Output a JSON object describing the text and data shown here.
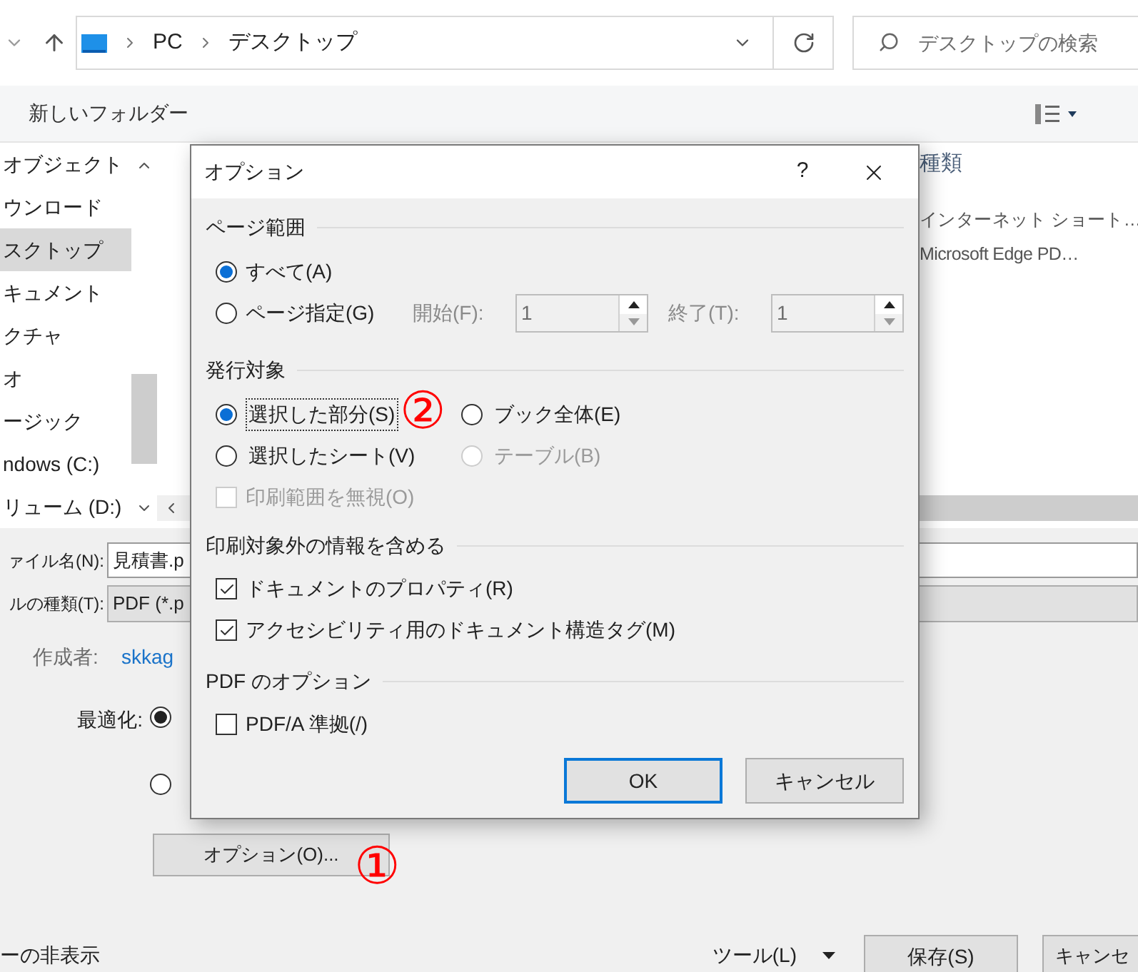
{
  "explorer": {
    "address": {
      "segments": [
        "PC",
        "デスクトップ"
      ]
    },
    "search": {
      "placeholder": "デスクトップの検索"
    },
    "toolbar": {
      "new_folder": "新しいフォルダー"
    },
    "sidebar": {
      "items": [
        {
          "label": "オブジェクト",
          "selected": false
        },
        {
          "label": "ウンロード",
          "selected": false
        },
        {
          "label": "スクトップ",
          "selected": true
        },
        {
          "label": "キュメント",
          "selected": false
        },
        {
          "label": "クチャ",
          "selected": false
        },
        {
          "label": "オ",
          "selected": false
        },
        {
          "label": "ージック",
          "selected": false
        },
        {
          "label": "ndows (C:)",
          "selected": false
        },
        {
          "label": "リューム (D:)",
          "selected": false
        }
      ]
    },
    "file_list": {
      "columns": [
        "種類"
      ],
      "rows": [
        {
          "type": "インターネット ショート…"
        },
        {
          "type": "Microsoft Edge PD…"
        }
      ]
    },
    "form": {
      "file_name": {
        "label": "ァイル名(N):",
        "value": "見積書.p"
      },
      "file_type": {
        "label": "ルの種類(T):",
        "value": "PDF (*.p"
      },
      "author": {
        "label": "作成者:",
        "value": "skkag"
      },
      "optimize": {
        "label": "最適化:",
        "options": [
          {
            "selected": true
          },
          {
            "selected": false
          }
        ]
      },
      "options_button": "オプション(O)...",
      "hide_folders": "ーの非表示"
    },
    "footer": {
      "tools": "ツール(L)",
      "save": "保存(S)",
      "cancel": "キャンセ"
    }
  },
  "dialog": {
    "title": "オプション",
    "help": "?",
    "page_range": {
      "title": "ページ範囲",
      "options": [
        {
          "label": "すべて(A)",
          "selected": true
        },
        {
          "label": "ページ指定(G)",
          "selected": false
        }
      ],
      "from": {
        "label": "開始(F):",
        "value": "1",
        "disabled": true
      },
      "to": {
        "label": "終了(T):",
        "value": "1",
        "disabled": true
      }
    },
    "publish": {
      "title": "発行対象",
      "options": [
        {
          "label": "選択した部分(S)",
          "selected": true,
          "disabled": false
        },
        {
          "label": "ブック全体(E)",
          "selected": false,
          "disabled": false
        },
        {
          "label": "選択したシート(V)",
          "selected": false,
          "disabled": false
        },
        {
          "label": "テーブル(B)",
          "selected": false,
          "disabled": true
        }
      ],
      "ignore_print_area": {
        "label": "印刷範囲を無視(O)",
        "checked": false,
        "disabled": true
      }
    },
    "non_print": {
      "title": "印刷対象外の情報を含める",
      "options": [
        {
          "label": "ドキュメントのプロパティ(R)",
          "checked": true,
          "disabled": false
        },
        {
          "label": "アクセシビリティ用のドキュメント構造タグ(M)",
          "checked": true,
          "disabled": false
        }
      ]
    },
    "pdf": {
      "title": "PDF のオプション",
      "options": [
        {
          "label": "PDF/A 準拠(/)",
          "checked": false,
          "disabled": false
        }
      ]
    },
    "buttons": [
      {
        "label": "OK",
        "default": true
      },
      {
        "label": "キャンセル",
        "default": false
      }
    ]
  },
  "annotations": [
    {
      "label": "①"
    },
    {
      "label": "②"
    }
  ]
}
